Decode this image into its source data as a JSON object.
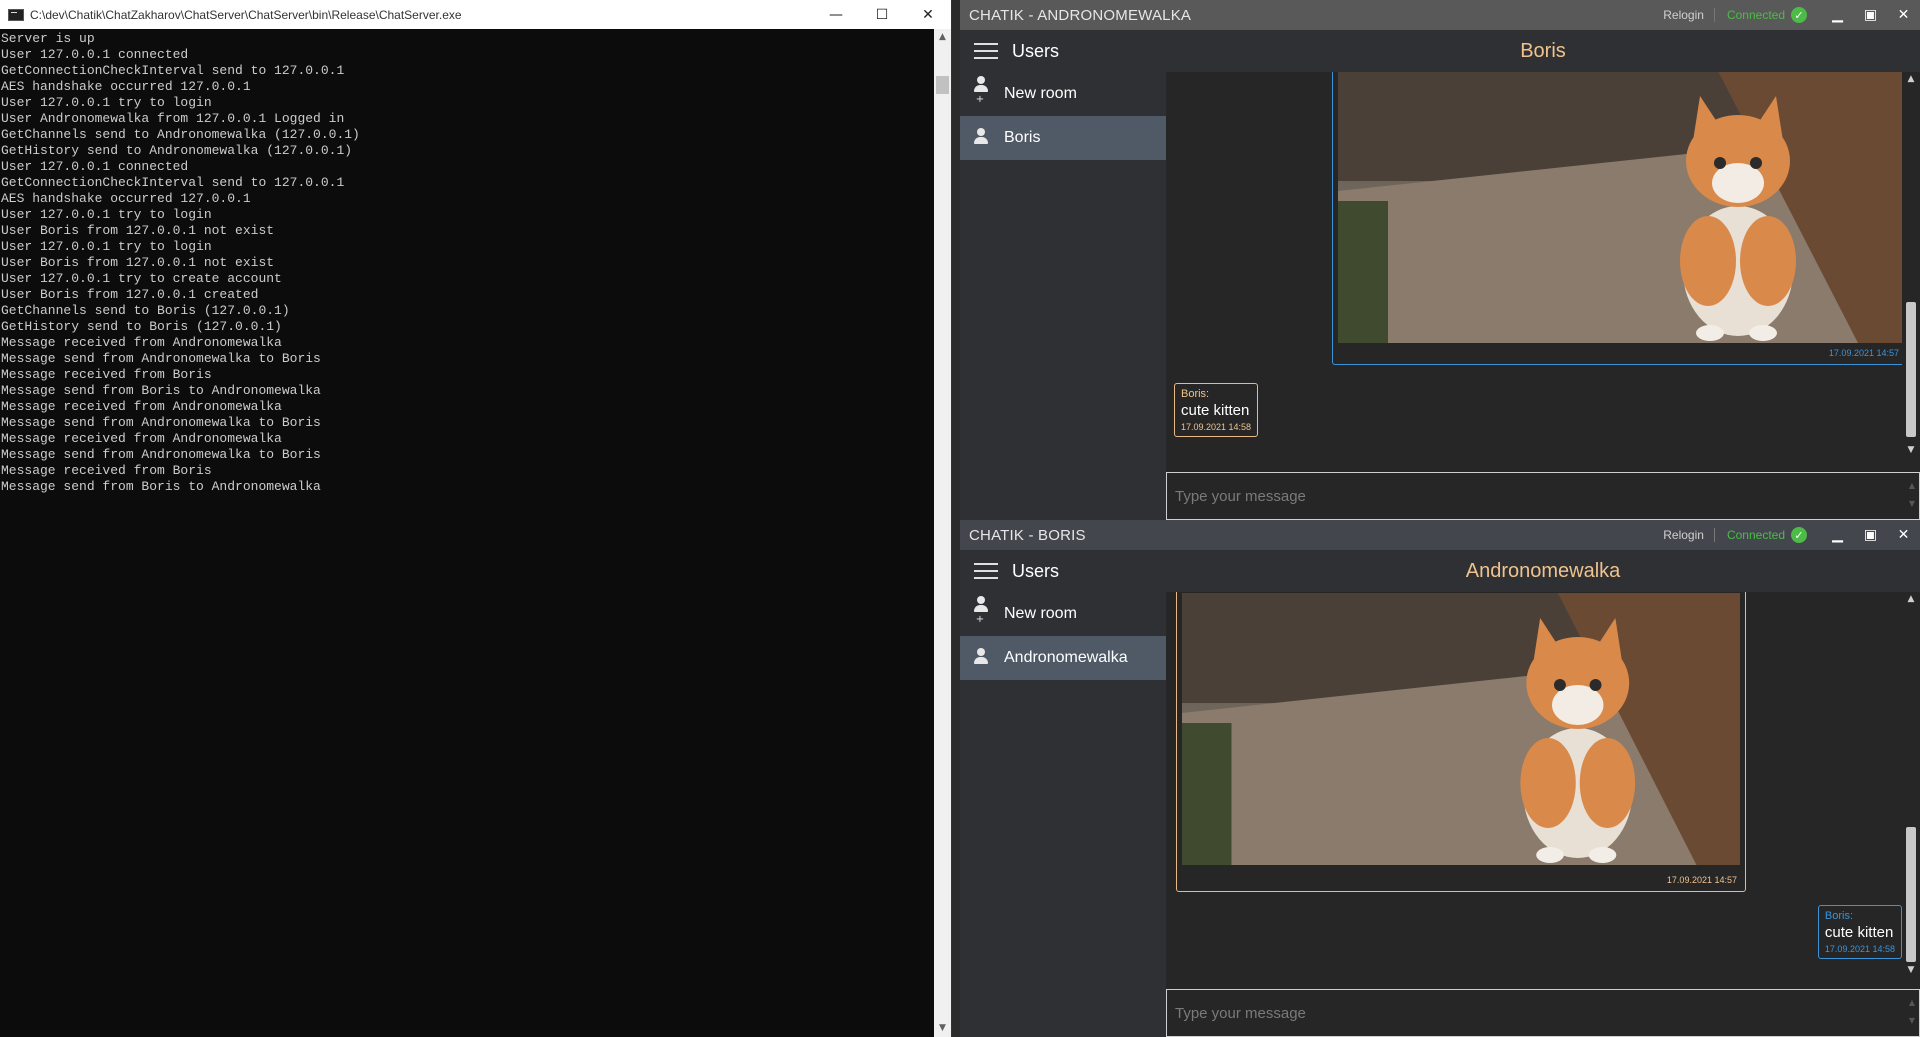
{
  "console": {
    "title": "C:\\dev\\Chatik\\ChatZakharov\\ChatServer\\ChatServer\\bin\\Release\\ChatServer.exe",
    "lines": [
      "Server is up",
      "User 127.0.0.1 connected",
      "GetConnectionCheckInterval send to 127.0.0.1",
      "AES handshake occurred 127.0.0.1",
      "User 127.0.0.1 try to login",
      "User Andronomewalka from 127.0.0.1 Logged in",
      "GetChannels send to Andronomewalka (127.0.0.1)",
      "GetHistory send to Andronomewalka (127.0.0.1)",
      "User 127.0.0.1 connected",
      "GetConnectionCheckInterval send to 127.0.0.1",
      "AES handshake occurred 127.0.0.1",
      "User 127.0.0.1 try to login",
      "User Boris from 127.0.0.1 not exist",
      "User 127.0.0.1 try to login",
      "User Boris from 127.0.0.1 not exist",
      "User 127.0.0.1 try to create account",
      "User Boris from 127.0.0.1 created",
      "GetChannels send to Boris (127.0.0.1)",
      "GetHistory send to Boris (127.0.0.1)",
      "Message received from Andronomewalka",
      "Message send from Andronomewalka to Boris",
      "Message received from Boris",
      "Message send from Boris to Andronomewalka",
      "Message received from Andronomewalka",
      "Message send from Andronomewalka to Boris",
      "Message received from Andronomewalka",
      "Message send from Andronomewalka to Boris",
      "Message received from Boris",
      "Message send from Boris to Andronomewalka"
    ],
    "minimize_glyph": "—",
    "maximize_glyph": "☐",
    "close_glyph": "✕"
  },
  "window_a": {
    "title": "CHATIK - ANDRONOMEWALKA",
    "relogin": "Relogin",
    "status": "Connected",
    "sidebar_title": "Users",
    "new_room": "New room",
    "rooms": [
      "Boris"
    ],
    "chat_title": "Boris",
    "image_time": "17.09.2021 14:57",
    "msg_sender": "Boris:",
    "msg_text": "cute kitten",
    "msg_time": "17.09.2021 14:58",
    "input_placeholder": "Type your message"
  },
  "window_b": {
    "title": "CHATIK - BORIS",
    "relogin": "Relogin",
    "status": "Connected",
    "sidebar_title": "Users",
    "new_room": "New room",
    "rooms": [
      "Andronomewalka"
    ],
    "chat_title": "Andronomewalka",
    "image_time": "17.09.2021 14:57",
    "msg_sender": "Boris:",
    "msg_text": "cute kitten",
    "msg_time": "17.09.2021 14:58",
    "input_placeholder": "Type your message"
  },
  "colors": {
    "accent_orange": "#f0c38e",
    "accent_blue": "#3b94d9",
    "connected_green": "#4cbb47",
    "console_bg": "#0c0c0c"
  },
  "icons": {
    "menu": "hamburger-menu-icon",
    "new_room": "add-user-icon",
    "room": "user-icon",
    "status": "check-circle-icon"
  }
}
